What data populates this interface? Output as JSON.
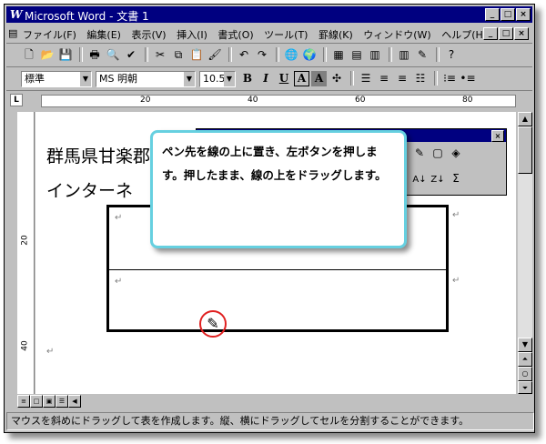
{
  "window": {
    "logo": "W",
    "title": "Microsoft Word - 文書 1",
    "min": "_",
    "max": "□",
    "close": "×"
  },
  "menu": {
    "items": [
      "ファイル(F)",
      "編集(E)",
      "表示(V)",
      "挿入(I)",
      "書式(O)",
      "ツール(T)",
      "罫線(K)",
      "ウィンドウ(W)",
      "ヘルプ(H)"
    ]
  },
  "format_toolbar": {
    "style": "標準",
    "font": "MS 明朝",
    "size": "10.5",
    "bold": "B",
    "italic": "I",
    "underline": "U",
    "border_char": "A",
    "shade_char": "A"
  },
  "ruler": {
    "h_labels": [
      "20",
      "40",
      "60",
      "80"
    ],
    "v_labels": [
      "20",
      "40"
    ]
  },
  "document": {
    "line1": "群馬県甘楽郡",
    "line2": "インターネ",
    "paragraph_mark": "↵"
  },
  "callout": {
    "text": "ペン先を線の上に置き、左ボタンを押します。押したまま、線の上をドラッグします。"
  },
  "table_toolbar": {
    "sort_asc": "A↓",
    "sort_desc": "Z↓",
    "sum": "Σ"
  },
  "status": {
    "text": "マウスを斜めにドラッグして表を作成します。縦、横にドラッグしてセルを分割することができます。"
  }
}
